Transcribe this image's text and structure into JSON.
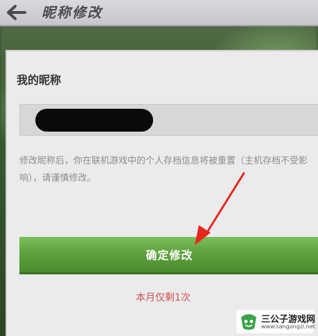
{
  "header": {
    "title": "昵称修改"
  },
  "dialog": {
    "title": "我的昵称",
    "warning": "修改昵称后，你在联机游戏中的个人存档信息将被重置（主机存档不受影响），请谨慎修改。",
    "confirm_label": "确定修改",
    "remaining": "本月仅剩1次"
  },
  "watermark": {
    "title": "三公子游戏网",
    "url": "www.sangongzi.net"
  },
  "colors": {
    "accent_green": "#5fa23e",
    "warning_red": "#d05050",
    "annotation_arrow": "#e8261f"
  },
  "icons": [
    "back-arrow-icon",
    "annotation-arrow-icon",
    "watermark-logo-icon"
  ]
}
